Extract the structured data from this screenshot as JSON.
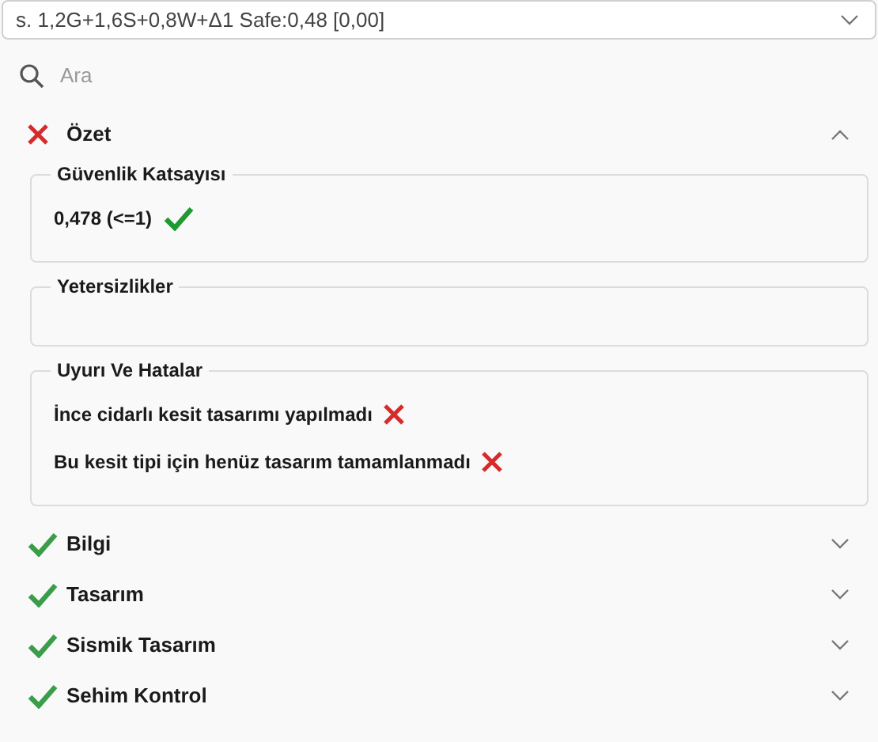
{
  "combo": {
    "value": "s. 1,2G+1,6S+0,8W+Δ1 Safe:0,48 [0,00]"
  },
  "search": {
    "placeholder": "Ara"
  },
  "sections": [
    {
      "title": "Özet",
      "kind": "cross",
      "expanded": true,
      "groups": [
        {
          "title": "Güvenlik Katsayısı",
          "items": [
            {
              "text": "0,478 (<=1)",
              "kind": "check"
            }
          ]
        },
        {
          "title": "Yetersizlikler"
        },
        {
          "title": "Uyurı Ve Hatalar",
          "items": [
            {
              "text": "İnce cidarlı kesit tasarımı yapılmadı",
              "kind": "cross"
            },
            {
              "text": "Bu kesit tipi için henüz tasarım tamamlanmadı",
              "kind": "cross"
            }
          ]
        }
      ]
    },
    {
      "title": "Bilgi",
      "kind": "check",
      "expanded": false
    },
    {
      "title": "Tasarım",
      "kind": "check",
      "expanded": false
    },
    {
      "title": "Sismik Tasarım",
      "kind": "check",
      "expanded": false
    },
    {
      "title": "Sehim Kontrol",
      "kind": "check",
      "expanded": false
    }
  ]
}
